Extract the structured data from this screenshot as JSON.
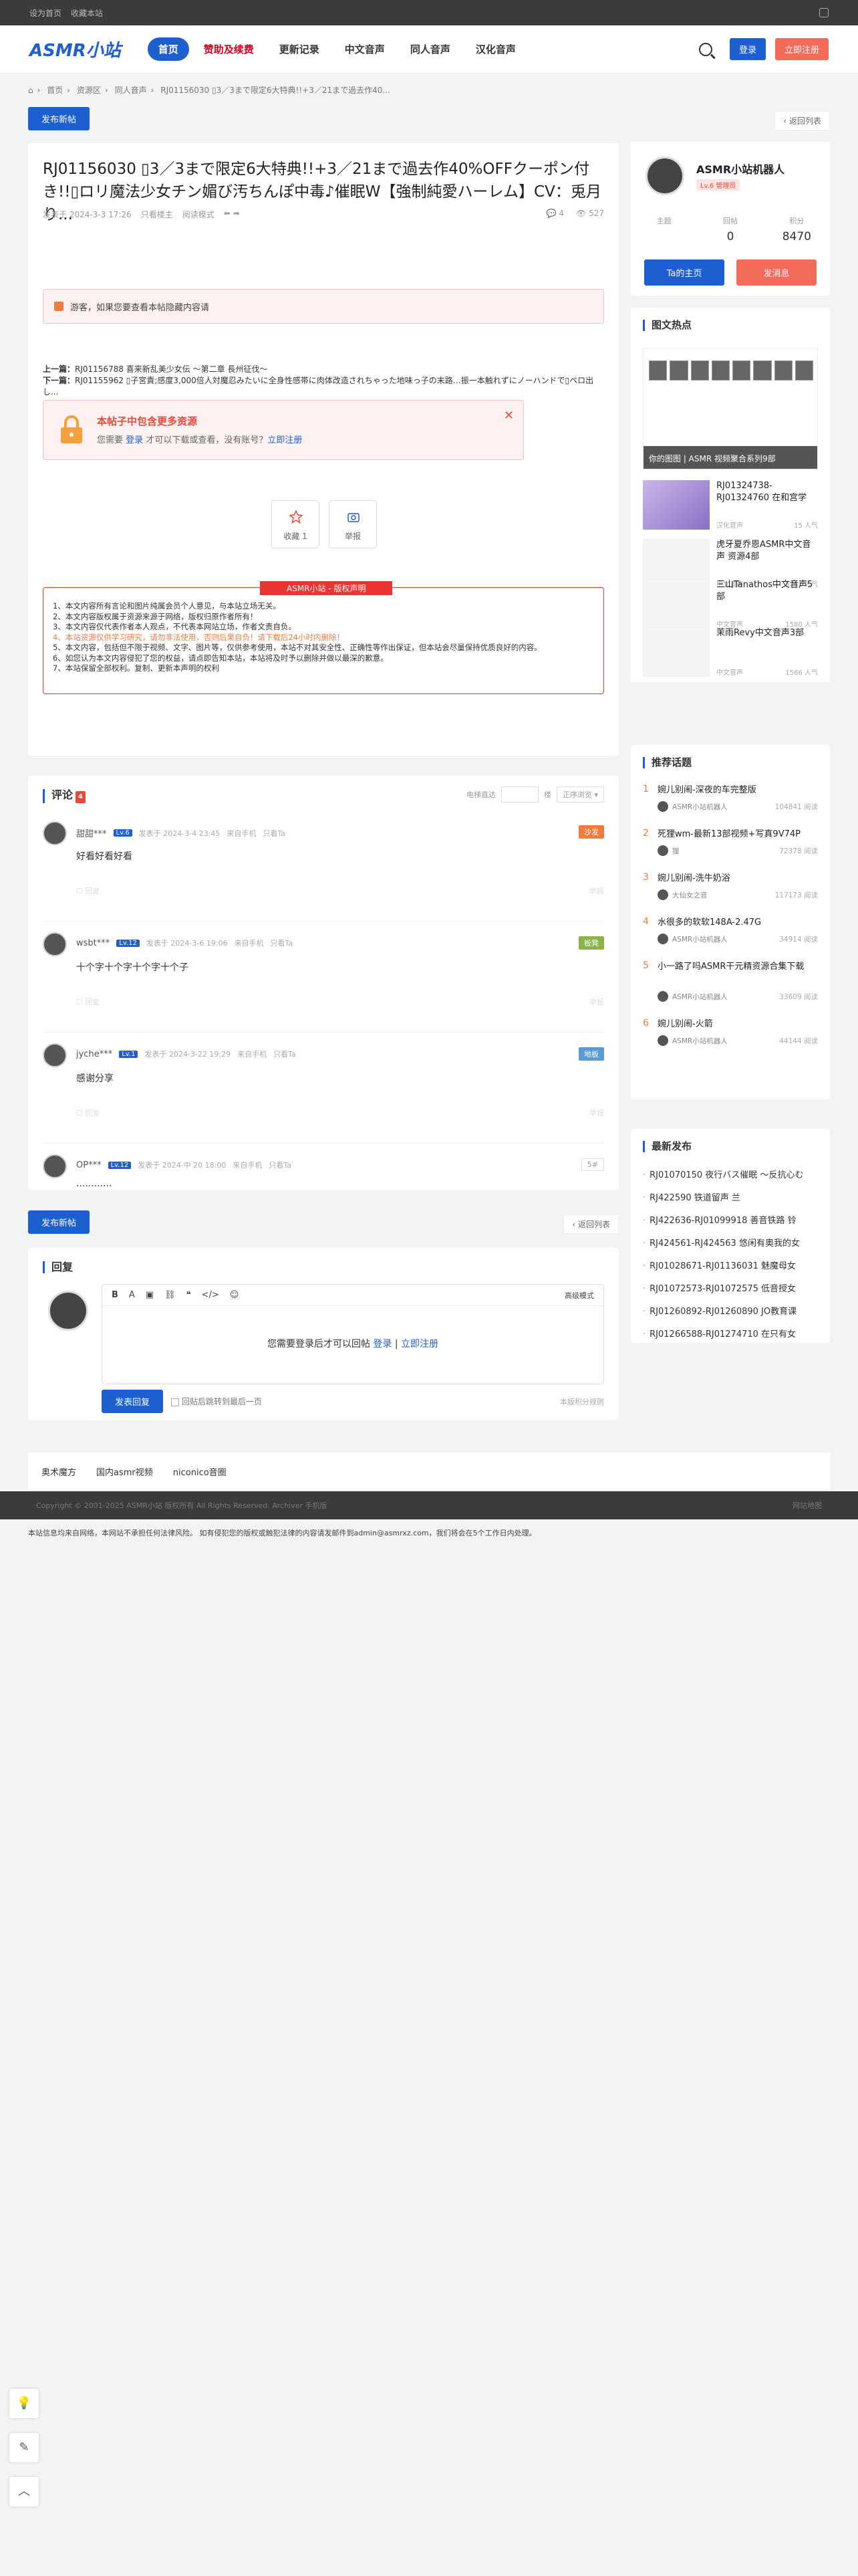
{
  "topbar": {
    "set_home": "设为首页",
    "bookmark": "收藏本站"
  },
  "header": {
    "logo": "ASMR小站",
    "nav": [
      {
        "label": "首页",
        "active": true
      },
      {
        "label": "赞助及续费",
        "red": true
      },
      {
        "label": "更新记录"
      },
      {
        "label": "中文音声"
      },
      {
        "label": "同人音声"
      },
      {
        "label": "汉化音声"
      }
    ],
    "login": "登录",
    "register": "立即注册"
  },
  "breadcrumb": [
    "首页",
    "资源区",
    "同人音声",
    "RJ01156030 ▯3／3まで限定6大特典!!+3／21まで過去作40..."
  ],
  "publish": "发布新帖",
  "back_list": "返回列表",
  "post": {
    "title": "RJ01156030 ▯3／3まで限定6大特典!!+3／21まで過去作40%OFFクーポン付き!!▯ロリ魔法少女チン媚び汚ちんぽ中毒♪催眠W【強制純愛ハーレム】CV：兎月り...",
    "meta_date": "发表于 2024-3-3 17:26",
    "meta_author": "只看楼主",
    "meta_mode": "阅读模式",
    "replies": "4",
    "views": "527",
    "guest_notice": "游客，如果您要查看本帖隐藏内容请",
    "prev_label": "上一篇：",
    "prev": "RJ01156788 喜来新乱美少女伝 〜第二章 長州征伐〜",
    "next_label": "下一篇：",
    "next": "RJ01155962 ▯子宮責;感度3,000倍人対魔忍みたいに全身性感帯に肉体改造されちゃった地味っ子の末路…振一本触れずにノーハンドで▯ペロ出し...",
    "hide_title": "本帖子中包含更多资源",
    "hide_need": "您需要",
    "hide_login": "登录",
    "hide_mid": "才可以下载或查看，没有账号？",
    "hide_reg": "立即注册",
    "fav": "收藏 1",
    "report": "举报",
    "copyright_head": "ASMR小站 - 版权声明",
    "copyright": [
      "1、本文内容所有言论和图片纯属会员个人意见，与本站立场无关。",
      "2、本文内容版权属于资源来源于网络，版权归原作者所有！",
      "3、本文内容仅代表作者本人观点，不代表本网站立场，作者文责自负。",
      "4、本站资源仅供学习研究，请勿非法使用，否则后果自负！请下载后24小时内删除！",
      "5、本文内容，包括但不限于视频、文字、图片等，仅供参考使用，本站不对其安全性、正确性等作出保证，但本站会尽量保持优质良好的内容。",
      "6、如您认为本文内容侵犯了您的权益，请点即告知本站，本站将及时予以删除并做以最深的歉意。",
      "7、本站保留全部权利。复制、更新本声明的权利"
    ]
  },
  "comments": {
    "title": "评论",
    "count": "4",
    "sort_label": "电梯直达",
    "floor_unit": "楼",
    "order": "正序浏览",
    "items": [
      {
        "name": "甜甜***",
        "lv": "Lv.6",
        "time": "发表于 2024-3-4 23:45",
        "dev": "来自手机",
        "only": "只看Ta",
        "text": "好看好看好看",
        "floor": "沙发",
        "color": "#f07b3f"
      },
      {
        "name": "wsbt***",
        "lv": "Lv.12",
        "time": "发表于 2024-3-6 19:06",
        "dev": "来自手机",
        "only": "只看Ta",
        "text": "十个字十个字十个字十个子",
        "floor": "板凳",
        "color": "#8bb34a"
      },
      {
        "name": "jyche***",
        "lv": "Lv.1",
        "time": "发表于 2024-3-22 19:29",
        "dev": "来自手机",
        "only": "只看Ta",
        "text": "感谢分享",
        "floor": "地板",
        "color": "#5a9bd5"
      },
      {
        "name": "OP***",
        "lv": "Lv.12",
        "time": "发表于 2024-中 20 18:00",
        "dev": "来自手机",
        "only": "只看Ta",
        "text": "............",
        "floor": "5#",
        "color": "#fff"
      }
    ]
  },
  "reply": {
    "title": "回复",
    "adv": "高级模式",
    "need": "您需要登录后才可以回帖",
    "login": "登录",
    "sep": "|",
    "reg": "立即注册",
    "send": "发表回复",
    "option": "回贴后跳转到最后一页",
    "points": "本版积分规则"
  },
  "links": [
    "奥术魔方",
    "国内asmr视频",
    "niconico音圈"
  ],
  "footer": {
    "copy": "Copyright © 2001-2025 ASMR小站 版权所有 All Rights Reserved.  Archiver  手机版",
    "map": "网站地图"
  },
  "disclaimer": "本站信息均来自网络，本网站不承担任何法律风险。 如有侵犯您的版权或触犯法律的内容请发邮件到admin@asmrxz.com，我们将会在5个工作日内处理。",
  "user": {
    "name": "ASMR小站机器人",
    "level": "Lv.6 管理员",
    "s1": "主题",
    "s1v": "",
    "s2": "回帖",
    "s2v": "0",
    "s3": "积分",
    "s3v": "8470",
    "home": "Ta的主页",
    "msg": "发消息"
  },
  "hot": {
    "title": "图文热点",
    "banner": "你的图图 | ASMR 视频聚合系列9部",
    "items": [
      {
        "t": "RJ01324738-RJ01324760 在和宫学",
        "cat": "汉化音声",
        "v": "15 人气"
      },
      {
        "t": "虎牙夏乔恩ASMR中文音声 资源4部",
        "cat": "中文音声",
        "v": "5251 人气"
      },
      {
        "t": "三山Tanathos中文音声5部",
        "cat": "中文音声",
        "v": "1580 人气"
      },
      {
        "t": "茉雨Revy中文音声3部",
        "cat": "中文音声",
        "v": "1566 人气"
      }
    ]
  },
  "rec": {
    "title": "推荐话题",
    "items": [
      {
        "n": "1",
        "t": "婉儿别闹-深夜的车完整版",
        "u": "ASMR小站机器人",
        "v": "104841 阅读"
      },
      {
        "n": "2",
        "t": "死狸wm-最新13部视频+写真9V74P",
        "u": "狸",
        "v": "72378 阅读"
      },
      {
        "n": "3",
        "t": "婉儿别闹-洗牛奶浴",
        "u": "大仙女之音",
        "v": "117173 阅读"
      },
      {
        "n": "4",
        "t": "水很多的软软148A-2.47G",
        "u": "ASMR小站机器人",
        "v": "34914 阅读"
      },
      {
        "n": "5",
        "t": "小一路了吗ASMR干元精资源合集下载",
        "u": "ASMR小站机器人",
        "v": "33609 阅读"
      },
      {
        "n": "6",
        "t": "婉儿别闹-火箭",
        "u": "ASMR小站机器人",
        "v": "44144 阅读"
      }
    ]
  },
  "latest": {
    "title": "最新发布",
    "items": [
      "RJ01070150 夜行バス催眠 〜反抗心む",
      "RJ422590 铁道留声 兰",
      "RJ422636-RJ01099918 善音铁路 铃",
      "RJ424561-RJ424563 悠闲有奥我的女",
      "RJ01028671-RJ01136031 魅魔母女",
      "RJ01072573-RJ01072575 低音授女",
      "RJ01260892-RJ01260890 JO教育课",
      "RJ01266588-RJ01274710 在只有女"
    ]
  }
}
